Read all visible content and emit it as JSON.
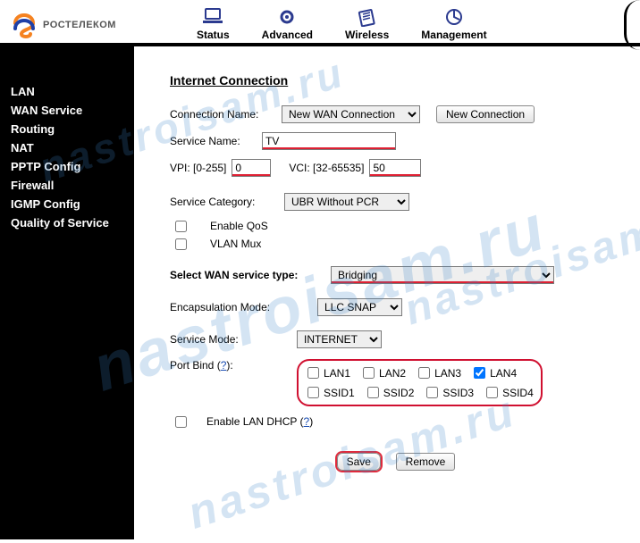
{
  "brand": {
    "name": "РОСТЕЛЕКОМ"
  },
  "tabs": {
    "status": "Status",
    "advanced": "Advanced",
    "wireless": "Wireless",
    "management": "Management"
  },
  "sidebar": {
    "items": [
      {
        "label": "LAN"
      },
      {
        "label": "WAN Service"
      },
      {
        "label": "Routing"
      },
      {
        "label": "NAT"
      },
      {
        "label": "PPTP Config"
      },
      {
        "label": "Firewall"
      },
      {
        "label": "IGMP Config"
      },
      {
        "label": "Quality of Service"
      }
    ]
  },
  "page": {
    "title": "Internet Connection",
    "connection_name_label": "Connection Name:",
    "connection_name_value": "New WAN Connection",
    "new_connection_btn": "New Connection",
    "service_name_label": "Service Name:",
    "service_name_value": "TV",
    "vpi_label": "VPI: [0-255]",
    "vpi_value": "0",
    "vci_label": "VCI: [32-65535]",
    "vci_value": "50",
    "service_category_label": "Service Category:",
    "service_category_value": "UBR Without PCR",
    "enable_qos_label": "Enable QoS",
    "vlan_mux_label": "VLAN Mux",
    "wan_type_label": "Select WAN service type:",
    "wan_type_value": "Bridging",
    "encap_label": "Encapsulation Mode:",
    "encap_value": "LLC SNAP",
    "service_mode_label": "Service Mode:",
    "service_mode_value": "INTERNET",
    "port_bind_label": "Port Bind (",
    "port_bind_hint": "?",
    "port_bind_close": "):",
    "ports": {
      "lan1": "LAN1",
      "lan2": "LAN2",
      "lan3": "LAN3",
      "lan4": "LAN4",
      "ssid1": "SSID1",
      "ssid2": "SSID2",
      "ssid3": "SSID3",
      "ssid4": "SSID4"
    },
    "enable_lan_dhcp_label": "Enable LAN DHCP (",
    "enable_lan_dhcp_hint": "?",
    "enable_lan_dhcp_close": ")",
    "save_btn": "Save",
    "remove_btn": "Remove"
  },
  "watermark": "nastroisam.ru"
}
